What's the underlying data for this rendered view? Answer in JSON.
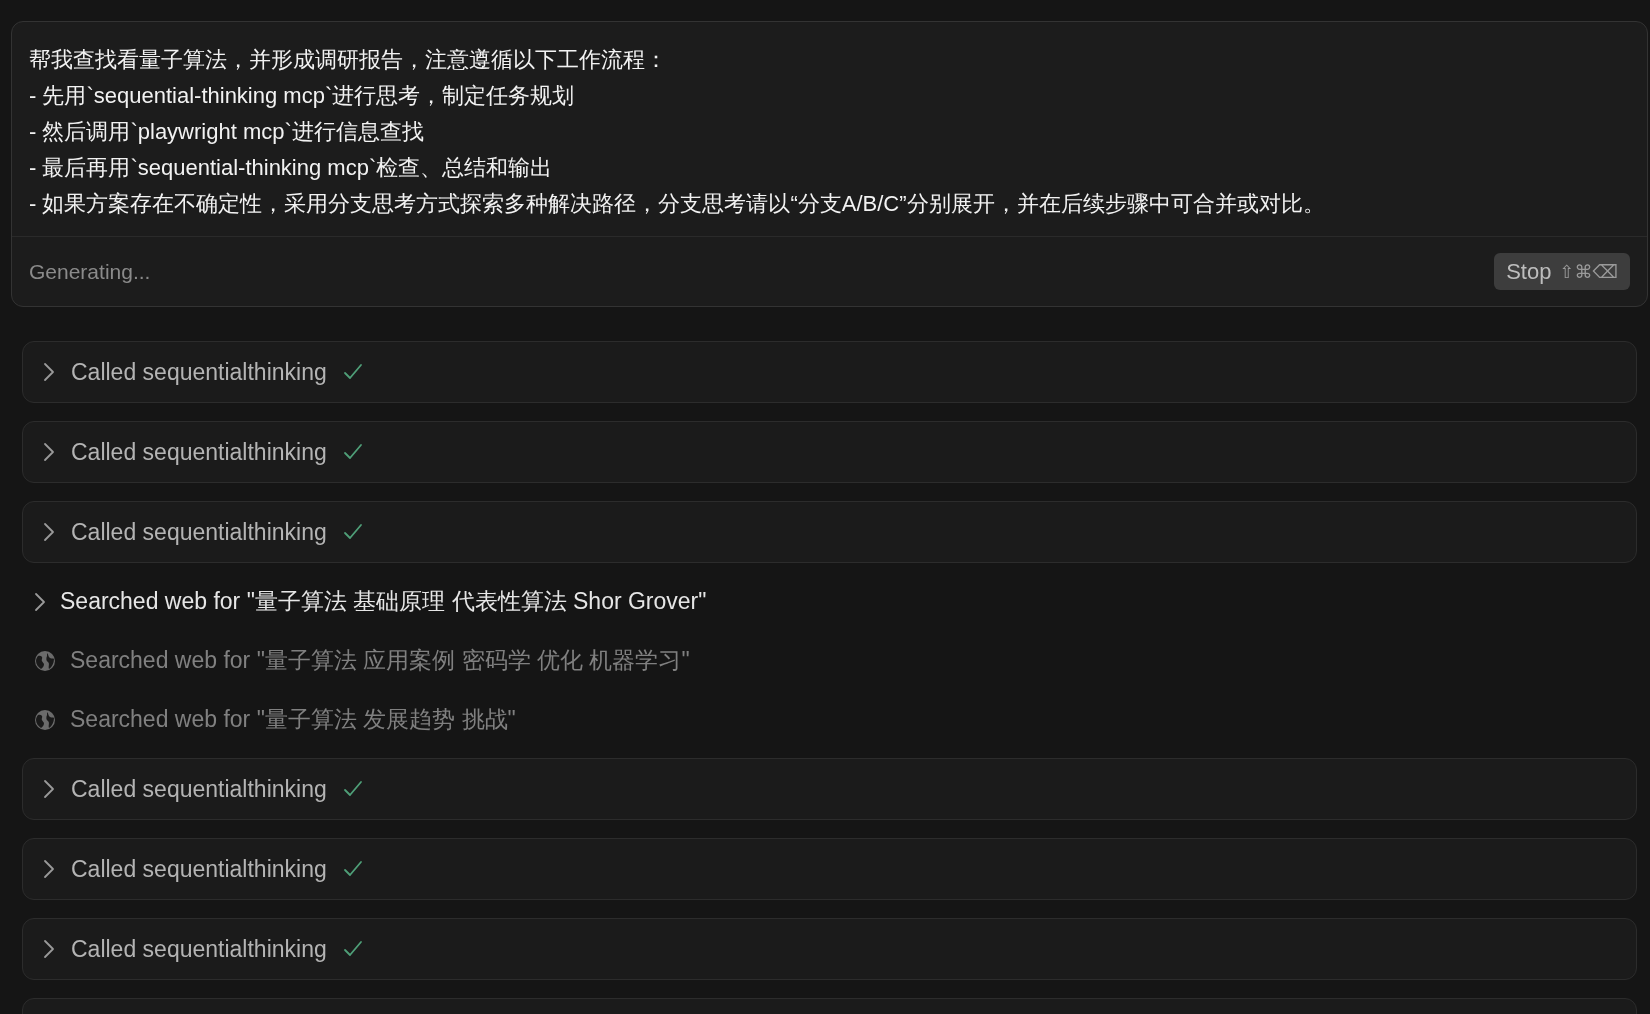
{
  "prompt": {
    "lines": [
      "帮我查找看量子算法，并形成调研报告，注意遵循以下工作流程：",
      "- 先用`sequential-thinking mcp`进行思考，制定任务规划",
      "- 然后调用`playwright mcp`进行信息查找",
      "- 最后再用`sequential-thinking mcp`检查、总结和输出",
      "- 如果方案存在不确定性，采用分支思考方式探索多种解决路径，分支思考请以“分支A/B/C”分别展开，并在后续步骤中可合并或对比。"
    ],
    "status": "Generating...",
    "stop_button": {
      "label": "Stop",
      "shortcut": "⇧⌘⌫"
    }
  },
  "steps": [
    {
      "kind": "tool",
      "label": "Called sequentialthinking",
      "done": true
    },
    {
      "kind": "tool",
      "label": "Called sequentialthinking",
      "done": true
    },
    {
      "kind": "tool",
      "label": "Called sequentialthinking",
      "done": true
    },
    {
      "kind": "search",
      "label": "Searched web for \"量子算法 基础原理 代表性算法 Shor Grover\"",
      "expandable": true
    },
    {
      "kind": "search",
      "label": "Searched web for \"量子算法 应用案例 密码学 优化 机器学习\"",
      "expandable": false
    },
    {
      "kind": "search",
      "label": "Searched web for \"量子算法 发展趋势 挑战\"",
      "expandable": false
    },
    {
      "kind": "tool",
      "label": "Called sequentialthinking",
      "done": true
    },
    {
      "kind": "tool",
      "label": "Called sequentialthinking",
      "done": true
    },
    {
      "kind": "tool",
      "label": "Called sequentialthinking",
      "done": true
    }
  ]
}
